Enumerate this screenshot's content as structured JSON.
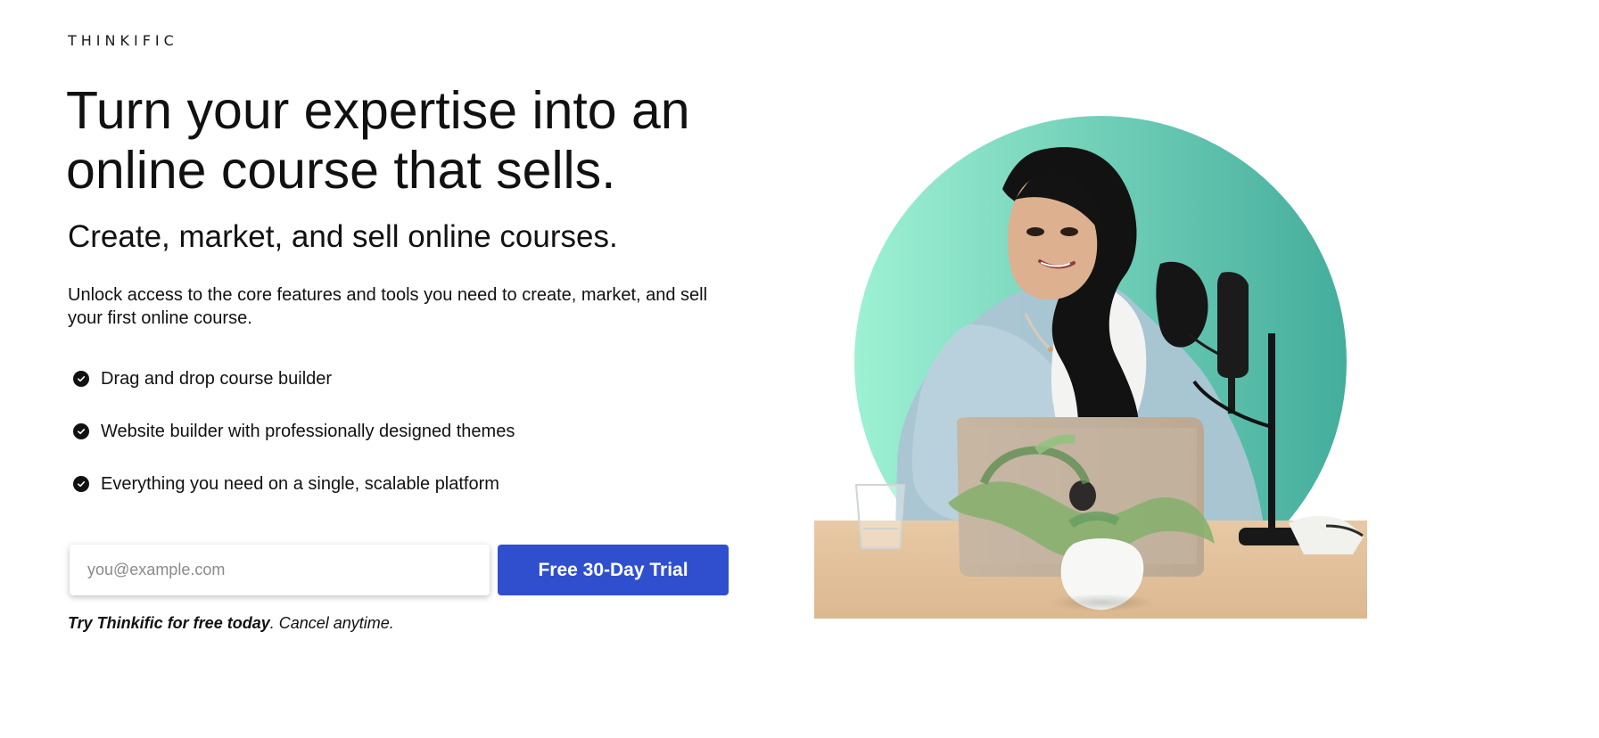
{
  "brand": {
    "logo": "THINKIFIC"
  },
  "hero": {
    "headline": "Turn your expertise into an online course that sells.",
    "subheadline": "Create, market, and sell online courses.",
    "description": "Unlock access to the core features and tools you need to create, market, and sell your first online course.",
    "features": [
      {
        "label": "Drag and drop course builder",
        "icon": "check-circle-icon"
      },
      {
        "label": "Website builder with professionally designed themes",
        "icon": "check-circle-icon"
      },
      {
        "label": "Everything you need on a single, scalable platform",
        "icon": "check-circle-icon"
      }
    ],
    "signup": {
      "email_placeholder": "you@example.com",
      "email_value": "",
      "button_label": "Free 30-Day Trial"
    },
    "note": {
      "bold": "Try Thinkific for free today",
      "regular": ". Cancel anytime."
    }
  },
  "colors": {
    "primary_button": "#2f4fcf",
    "circle_gradient_start": "#9ef1d3",
    "circle_gradient_end": "#44ad9c",
    "text": "#111111"
  },
  "image": {
    "description_name": "woman-at-desk-with-microphone-and-laptop"
  }
}
